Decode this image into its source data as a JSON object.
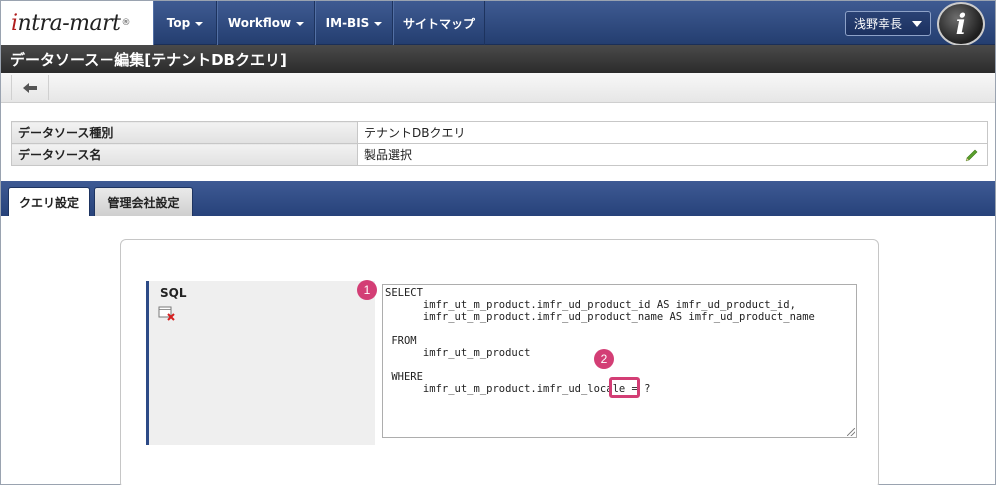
{
  "logo": {
    "text_i": "i",
    "text_rest": "ntra-mart",
    "reg": "®"
  },
  "nav": [
    {
      "label": "Top",
      "dropdown": true
    },
    {
      "label": "Workflow",
      "dropdown": true
    },
    {
      "label": "IM-BIS",
      "dropdown": true
    },
    {
      "label": "サイトマップ",
      "dropdown": false
    }
  ],
  "user": {
    "name": "浅野幸長"
  },
  "badge_letter": "i",
  "page_title": "データソース－編集[テナントDBクエリ]",
  "info": [
    {
      "label": "データソース種別",
      "value": "テナントDBクエリ",
      "editable": false
    },
    {
      "label": "データソース名",
      "value": "製品選択",
      "editable": true
    }
  ],
  "tabs": [
    {
      "label": "クエリ設定",
      "active": true
    },
    {
      "label": "管理会社設定",
      "active": false
    }
  ],
  "sql": {
    "label": "SQL",
    "text": "SELECT\n      imfr_ut_m_product.imfr_ud_product_id AS imfr_ud_product_id,\n      imfr_ut_m_product.imfr_ud_product_name AS imfr_ud_product_name\n\n FROM\n      imfr_ut_m_product\n\n WHERE\n      imfr_ut_m_product.imfr_ud_locale = ?"
  },
  "annotations": [
    "1",
    "2"
  ],
  "colors": {
    "nav_bg": "#2f4a80",
    "title_bg": "#333333",
    "accent": "#d33e75"
  }
}
